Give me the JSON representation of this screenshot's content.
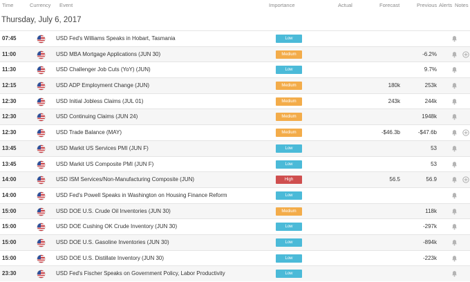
{
  "header": {
    "time": "Time",
    "currency": "Currency",
    "event": "Event",
    "importance": "Importance",
    "actual": "Actual",
    "forecast": "Forecast",
    "previous": "Previous",
    "alerts": "Alerts",
    "notes": "Notes"
  },
  "date_heading": "Thursday, July 6, 2017",
  "colors": {
    "low": "#4bbad8",
    "medium": "#f3ac4a",
    "high": "#cf4f4f"
  },
  "rows": [
    {
      "time": "07:45",
      "currency_icon": "us-flag-icon",
      "event": "USD Fed's Williams Speaks in Hobart, Tasmania",
      "importance": "Low",
      "forecast": "",
      "previous": "",
      "has_note": false
    },
    {
      "time": "11:00",
      "currency_icon": "us-flag-icon",
      "event": "USD MBA Mortgage Applications (JUN 30)",
      "importance": "Medium",
      "forecast": "",
      "previous": "-6.2%",
      "has_note": true
    },
    {
      "time": "11:30",
      "currency_icon": "us-flag-icon",
      "event": "USD Challenger Job Cuts (YoY) (JUN)",
      "importance": "Low",
      "forecast": "",
      "previous": "9.7%",
      "has_note": false
    },
    {
      "time": "12:15",
      "currency_icon": "us-flag-icon",
      "event": "USD ADP Employment Change (JUN)",
      "importance": "Medium",
      "forecast": "180k",
      "previous": "253k",
      "has_note": false
    },
    {
      "time": "12:30",
      "currency_icon": "us-flag-icon",
      "event": "USD Initial Jobless Claims (JUL 01)",
      "importance": "Medium",
      "forecast": "243k",
      "previous": "244k",
      "has_note": false
    },
    {
      "time": "12:30",
      "currency_icon": "us-flag-icon",
      "event": "USD Continuing Claims (JUN 24)",
      "importance": "Medium",
      "forecast": "",
      "previous": "1948k",
      "has_note": false
    },
    {
      "time": "12:30",
      "currency_icon": "us-flag-icon",
      "event": "USD Trade Balance (MAY)",
      "importance": "Medium",
      "forecast": "-$46.3b",
      "previous": "-$47.6b",
      "has_note": true
    },
    {
      "time": "13:45",
      "currency_icon": "us-flag-icon",
      "event": "USD Markit US Services PMI (JUN F)",
      "importance": "Low",
      "forecast": "",
      "previous": "53",
      "has_note": false
    },
    {
      "time": "13:45",
      "currency_icon": "us-flag-icon",
      "event": "USD Markit US Composite PMI (JUN F)",
      "importance": "Low",
      "forecast": "",
      "previous": "53",
      "has_note": false
    },
    {
      "time": "14:00",
      "currency_icon": "us-flag-icon",
      "event": "USD ISM Services/Non-Manufacturing Composite (JUN)",
      "importance": "High",
      "forecast": "56.5",
      "previous": "56.9",
      "has_note": true
    },
    {
      "time": "14:00",
      "currency_icon": "us-flag-icon",
      "event": "USD Fed's Powell Speaks in Washington on Housing Finance Reform",
      "importance": "Low",
      "forecast": "",
      "previous": "",
      "has_note": false
    },
    {
      "time": "15:00",
      "currency_icon": "us-flag-icon",
      "event": "USD DOE U.S. Crude Oil Inventories (JUN 30)",
      "importance": "Medium",
      "forecast": "",
      "previous": "118k",
      "has_note": false
    },
    {
      "time": "15:00",
      "currency_icon": "us-flag-icon",
      "event": "USD DOE Cushing OK Crude Inventory (JUN 30)",
      "importance": "Low",
      "forecast": "",
      "previous": "-297k",
      "has_note": false
    },
    {
      "time": "15:00",
      "currency_icon": "us-flag-icon",
      "event": "USD DOE U.S. Gasoline Inventories (JUN 30)",
      "importance": "Low",
      "forecast": "",
      "previous": "-894k",
      "has_note": false
    },
    {
      "time": "15:00",
      "currency_icon": "us-flag-icon",
      "event": "USD DOE U.S. Distillate Inventory (JUN 30)",
      "importance": "Low",
      "forecast": "",
      "previous": "-223k",
      "has_note": false
    },
    {
      "time": "23:30",
      "currency_icon": "us-flag-icon",
      "event": "USD Fed's Fischer Speaks on Government Policy, Labor Productivity",
      "importance": "Low",
      "forecast": "",
      "previous": "",
      "has_note": false
    }
  ]
}
